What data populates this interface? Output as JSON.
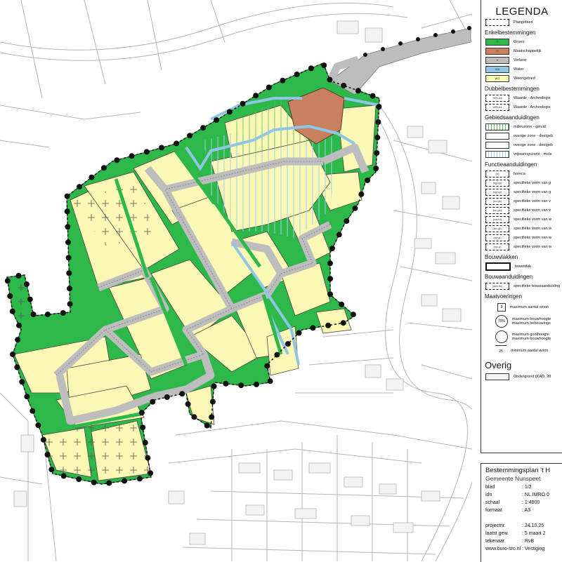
{
  "legend": {
    "title": "LEGENDA",
    "plangebied": "Plangebied",
    "enkel_title": "Enkelbestemmingen",
    "enkel": [
      {
        "code": "G",
        "label": "Groen",
        "color": "#2db84a"
      },
      {
        "code": "M",
        "label": "Maatschappelijk",
        "color": "#c8805e"
      },
      {
        "code": "V",
        "label": "Verkeer",
        "color": "#bdbdbd"
      },
      {
        "code": "WA",
        "label": "Water",
        "color": "#8fc6e6"
      },
      {
        "code": "WG",
        "label": "Woongebied",
        "color": "#fbf7b4"
      }
    ],
    "dubbel_title": "Dubbelbestemmingen",
    "dubbel": [
      {
        "code": "WR-A3",
        "label": "Waarde - Archeologie"
      },
      {
        "code": "WR-A4",
        "label": "Waarde - Archeologie"
      }
    ],
    "gebied_title": "Gebiedsaanduidingen",
    "gebied": [
      {
        "label": "milieuzone - geluid"
      },
      {
        "label": "overige zone - deelgeb"
      },
      {
        "label": "overige zone - deelgeb"
      },
      {
        "label": "vrijwaringszone - mole"
      }
    ],
    "functie_title": "Functieaanduidingen",
    "functie": [
      {
        "code": "(h)",
        "label": "horeca"
      },
      {
        "code": "(sg-bp)",
        "label": "specifieke vorm van g"
      },
      {
        "code": "(sg-bp)",
        "label": "specifieke vorm van g"
      },
      {
        "code": "(sv-gs)",
        "label": "specifieke vorm van v"
      },
      {
        "code": "(sv-gs)",
        "label": "specifieke vorm van v"
      },
      {
        "code": "(sw-bf)",
        "label": "specifieke vorm van w"
      },
      {
        "code": "(sw-gb)",
        "label": "specifieke vorm van w"
      },
      {
        "code": "(sw-p)",
        "label": "specifieke vorm van w"
      },
      {
        "code": "(sw-p)",
        "label": "specifieke vorm van w"
      }
    ],
    "bouwvlak_title": "Bouwvlakken",
    "bouwvlak_label": "bouwvlak",
    "bouwaand_title": "Bouwaanduidingen",
    "bouwaand": {
      "code": "(sba-bv)",
      "label": "specifieke bouwaanduiding"
    },
    "maat_title": "Maatvoeringen",
    "maat": [
      {
        "symbol": "3",
        "label": "maximum aantal woon"
      },
      {
        "symbol": "70%",
        "label": "maximum bouwhoogte",
        "label2": "maximum bebouwings"
      },
      {
        "symbol": "",
        "label": "maximum goothoogte",
        "label2": "maximum bouwhoogte"
      },
      {
        "symbol": "25",
        "label": "minimum aantal woon"
      }
    ],
    "overig_title": "Overig",
    "overig": {
      "label": "Ondergrond (KAD, 20"
    }
  },
  "titleblock": {
    "title": "Bestemmingsplan 't H",
    "subtitle": "Gemeente Nunspeet",
    "rows": [
      {
        "k": "blad",
        "v": ": 1/2"
      },
      {
        "k": "idn",
        "v": ": NL.IMRO.0"
      },
      {
        "k": "schaal",
        "v": ": 1:4000"
      },
      {
        "k": "formaat",
        "v": ": A3"
      },
      {
        "k": "",
        "v": ""
      },
      {
        "k": "projectnr.",
        "v": ": 24.10.25"
      },
      {
        "k": "laatst gew.",
        "v": ": 5 maart 2"
      },
      {
        "k": "tekenaar",
        "v": ": RvB"
      },
      {
        "k": "www.buro-sro.nl",
        "v": ": Vestiging"
      }
    ]
  },
  "colors": {
    "groen": "#2db84a",
    "woon": "#fbf7b4",
    "verkeer": "#bdbdbd",
    "water": "#8fc6e6",
    "maatsch": "#c8805e",
    "boundary": "#111111"
  }
}
